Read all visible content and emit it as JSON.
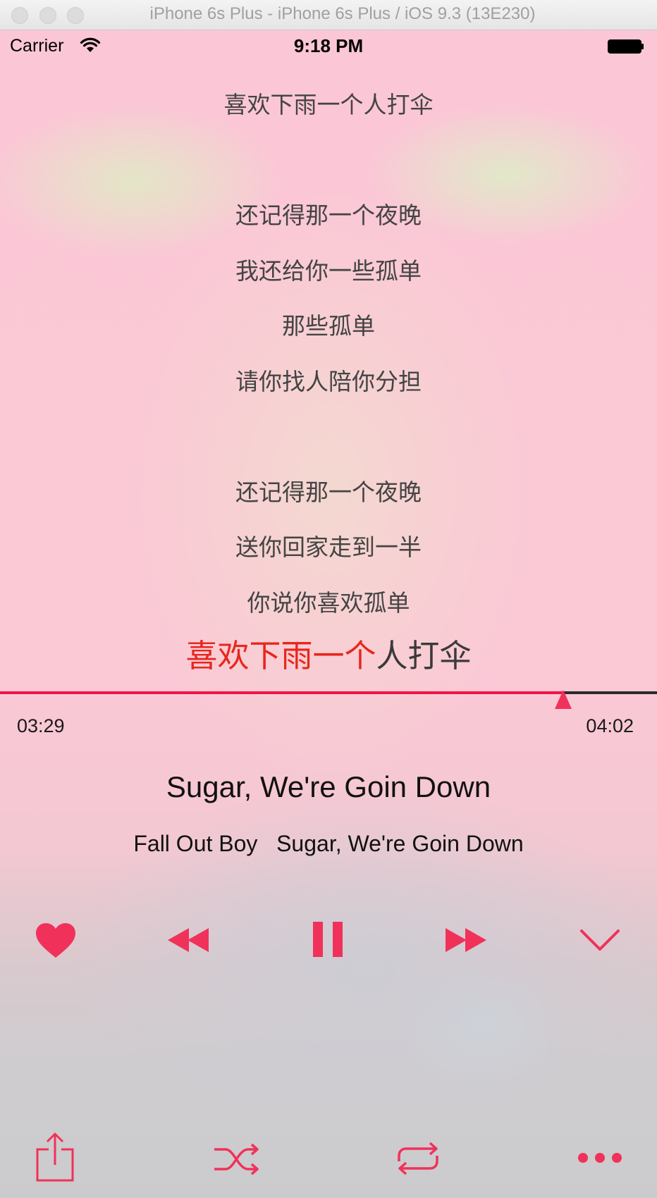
{
  "window": {
    "title": "iPhone 6s Plus - iPhone 6s Plus / iOS 9.3 (13E230)"
  },
  "status_bar": {
    "carrier": "Carrier",
    "time": "9:18 PM"
  },
  "lyrics": {
    "lines": [
      "喜欢下雨一个人打伞",
      "还记得那一个夜晚",
      "我还给你一些孤单",
      "那些孤单",
      "请你找人陪你分担",
      "还记得那一个夜晚",
      "送你回家走到一半",
      "你说你喜欢孤单"
    ],
    "current": {
      "sung": "喜欢下雨一个",
      "unsung": "人打伞"
    }
  },
  "player": {
    "elapsed": "03:29",
    "duration": "04:02",
    "progress": 0.857,
    "song_title": "Sugar, We're Goin Down",
    "artist": "Fall Out Boy",
    "album": "Sugar, We're Goin Down"
  },
  "colors": {
    "accent": "#f0325a",
    "lyric_highlight": "#e8261d",
    "progress_track": "#2b2b2b"
  },
  "icons": {
    "favorite": "heart-icon",
    "previous": "rewind-icon",
    "play_pause": "pause-icon",
    "next": "fast-forward-icon",
    "collapse": "chevron-down-icon",
    "share": "share-icon",
    "shuffle": "shuffle-icon",
    "repeat": "repeat-icon",
    "more": "more-icon"
  }
}
